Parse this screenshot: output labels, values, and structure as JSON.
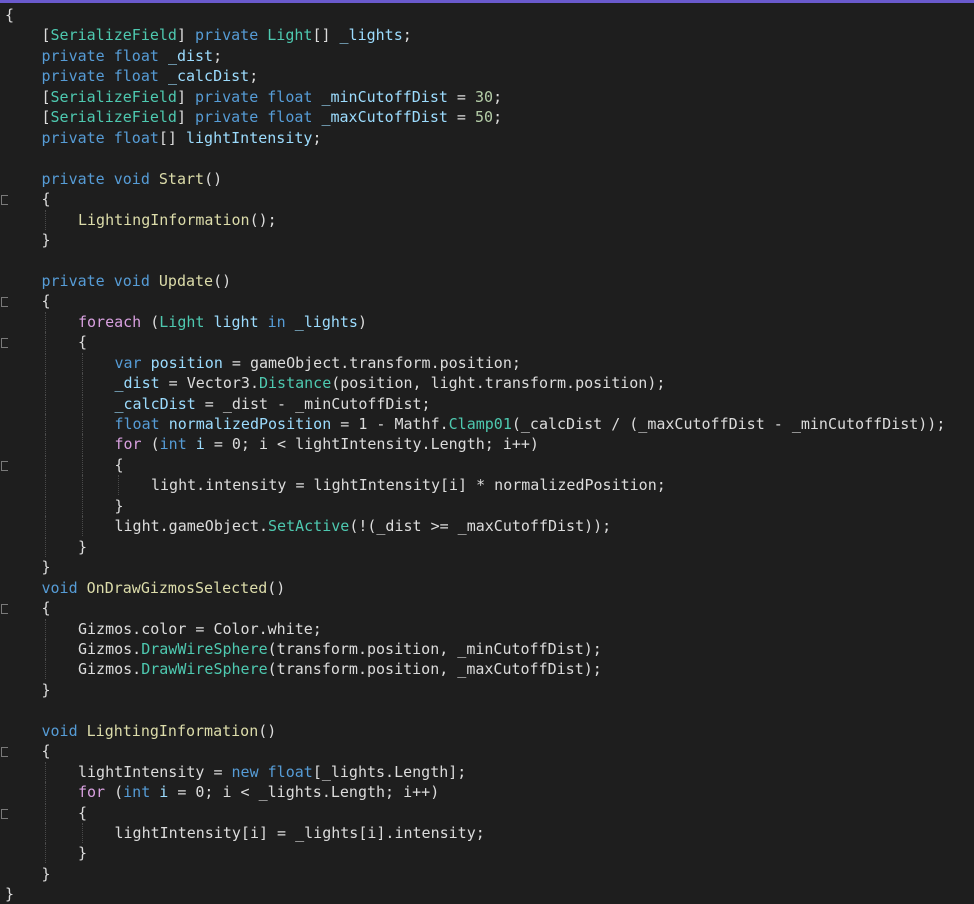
{
  "editor": {
    "lines": [
      {
        "indent": 0,
        "tokens": [
          [
            "br",
            "{"
          ]
        ],
        "fold": false
      },
      {
        "indent": 1,
        "tokens": [
          [
            "br",
            "["
          ],
          [
            "at",
            "SerializeField"
          ],
          [
            "br",
            "] "
          ],
          [
            "kw",
            "private "
          ],
          [
            "ty",
            "Light"
          ],
          [
            "br",
            "[] "
          ],
          [
            "vr",
            "_lights"
          ],
          [
            "br",
            ";"
          ]
        ]
      },
      {
        "indent": 1,
        "tokens": [
          [
            "kw",
            "private "
          ],
          [
            "kw",
            "float "
          ],
          [
            "vr",
            "_dist"
          ],
          [
            "br",
            ";"
          ]
        ]
      },
      {
        "indent": 1,
        "tokens": [
          [
            "kw",
            "private "
          ],
          [
            "kw",
            "float "
          ],
          [
            "vr",
            "_calcDist"
          ],
          [
            "br",
            ";"
          ]
        ]
      },
      {
        "indent": 1,
        "tokens": [
          [
            "br",
            "["
          ],
          [
            "at",
            "SerializeField"
          ],
          [
            "br",
            "] "
          ],
          [
            "kw",
            "private "
          ],
          [
            "kw",
            "float "
          ],
          [
            "vr",
            "_minCutoffDist"
          ],
          [
            "br",
            " = "
          ],
          [
            "nu",
            "30"
          ],
          [
            "br",
            ";"
          ]
        ]
      },
      {
        "indent": 1,
        "tokens": [
          [
            "br",
            "["
          ],
          [
            "at",
            "SerializeField"
          ],
          [
            "br",
            "] "
          ],
          [
            "kw",
            "private "
          ],
          [
            "kw",
            "float "
          ],
          [
            "vr",
            "_maxCutoffDist"
          ],
          [
            "br",
            " = "
          ],
          [
            "nu",
            "50"
          ],
          [
            "br",
            ";"
          ]
        ]
      },
      {
        "indent": 1,
        "tokens": [
          [
            "kw",
            "private "
          ],
          [
            "kw",
            "float"
          ],
          [
            "br",
            "[] "
          ],
          [
            "vr",
            "lightIntensity"
          ],
          [
            "br",
            ";"
          ]
        ]
      },
      {
        "indent": 1,
        "tokens": []
      },
      {
        "indent": 1,
        "tokens": [
          [
            "kw",
            "private "
          ],
          [
            "kw",
            "void "
          ],
          [
            "fn",
            "Start"
          ],
          [
            "br",
            "()"
          ]
        ]
      },
      {
        "indent": 1,
        "tokens": [
          [
            "br",
            "{"
          ]
        ],
        "fold": true
      },
      {
        "indent": 2,
        "tokens": [
          [
            "fn",
            "LightingInformation"
          ],
          [
            "br",
            "();"
          ]
        ]
      },
      {
        "indent": 1,
        "tokens": [
          [
            "br",
            "}"
          ]
        ]
      },
      {
        "indent": 1,
        "tokens": []
      },
      {
        "indent": 1,
        "tokens": [
          [
            "kw",
            "private "
          ],
          [
            "kw",
            "void "
          ],
          [
            "fn",
            "Update"
          ],
          [
            "br",
            "()"
          ]
        ]
      },
      {
        "indent": 1,
        "tokens": [
          [
            "br",
            "{"
          ]
        ],
        "fold": true
      },
      {
        "indent": 2,
        "tokens": [
          [
            "ctl",
            "foreach "
          ],
          [
            "br",
            "("
          ],
          [
            "ty",
            "Light "
          ],
          [
            "vr",
            "light "
          ],
          [
            "kw",
            "in "
          ],
          [
            "vr",
            "_lights"
          ],
          [
            "br",
            ")"
          ]
        ]
      },
      {
        "indent": 2,
        "tokens": [
          [
            "br",
            "{"
          ]
        ],
        "fold": true
      },
      {
        "indent": 3,
        "tokens": [
          [
            "kw",
            "var "
          ],
          [
            "vr",
            "position "
          ],
          [
            "br",
            "= gameObject.transform.position;"
          ]
        ]
      },
      {
        "indent": 3,
        "tokens": [
          [
            "vr",
            "_dist"
          ],
          [
            "br",
            " = Vector3."
          ],
          [
            "mt",
            "Distance"
          ],
          [
            "br",
            "(position, light.transform.position);"
          ]
        ]
      },
      {
        "indent": 3,
        "tokens": [
          [
            "vr",
            "_calcDist"
          ],
          [
            "br",
            " = _dist - _minCutoffDist;"
          ]
        ]
      },
      {
        "indent": 3,
        "tokens": [
          [
            "kw",
            "float "
          ],
          [
            "vr",
            "normalizedPosition"
          ],
          [
            "br",
            " = 1 - Mathf."
          ],
          [
            "mt",
            "Clamp01"
          ],
          [
            "br",
            "(_calcDist / (_maxCutoffDist - _minCutoffDist));"
          ]
        ]
      },
      {
        "indent": 3,
        "tokens": [
          [
            "ctl",
            "for "
          ],
          [
            "br",
            "("
          ],
          [
            "kw",
            "int "
          ],
          [
            "vr",
            "i"
          ],
          [
            "br",
            " = 0; i < lightIntensity.Length; i++)"
          ]
        ]
      },
      {
        "indent": 3,
        "tokens": [
          [
            "br",
            "{"
          ]
        ],
        "fold": true
      },
      {
        "indent": 4,
        "tokens": [
          [
            "br",
            "light.intensity = lightIntensity[i] * normalizedPosition;"
          ]
        ]
      },
      {
        "indent": 3,
        "tokens": [
          [
            "br",
            "}"
          ]
        ]
      },
      {
        "indent": 3,
        "tokens": [
          [
            "br",
            "light.gameObject."
          ],
          [
            "mt",
            "SetActive"
          ],
          [
            "br",
            "(!(_dist >= _maxCutoffDist));"
          ]
        ]
      },
      {
        "indent": 2,
        "tokens": [
          [
            "br",
            "}"
          ]
        ]
      },
      {
        "indent": 1,
        "tokens": [
          [
            "br",
            "}"
          ]
        ]
      },
      {
        "indent": 1,
        "tokens": [
          [
            "kw",
            "void "
          ],
          [
            "fn",
            "OnDrawGizmosSelected"
          ],
          [
            "br",
            "()"
          ]
        ]
      },
      {
        "indent": 1,
        "tokens": [
          [
            "br",
            "{"
          ]
        ],
        "fold": true
      },
      {
        "indent": 2,
        "tokens": [
          [
            "br",
            "Gizmos.color = Color.white;"
          ]
        ]
      },
      {
        "indent": 2,
        "tokens": [
          [
            "br",
            "Gizmos."
          ],
          [
            "mt",
            "DrawWireSphere"
          ],
          [
            "br",
            "(transform.position, _minCutoffDist);"
          ]
        ]
      },
      {
        "indent": 2,
        "tokens": [
          [
            "br",
            "Gizmos."
          ],
          [
            "mt",
            "DrawWireSphere"
          ],
          [
            "br",
            "(transform.position, _maxCutoffDist);"
          ]
        ]
      },
      {
        "indent": 1,
        "tokens": [
          [
            "br",
            "}"
          ]
        ]
      },
      {
        "indent": 1,
        "tokens": []
      },
      {
        "indent": 1,
        "tokens": [
          [
            "kw",
            "void "
          ],
          [
            "fn",
            "LightingInformation"
          ],
          [
            "br",
            "()"
          ]
        ]
      },
      {
        "indent": 1,
        "tokens": [
          [
            "br",
            "{"
          ]
        ],
        "fold": true
      },
      {
        "indent": 2,
        "tokens": [
          [
            "br",
            "lightIntensity = "
          ],
          [
            "kw",
            "new "
          ],
          [
            "kw",
            "float"
          ],
          [
            "br",
            "[_lights.Length];"
          ]
        ]
      },
      {
        "indent": 2,
        "tokens": [
          [
            "ctl",
            "for "
          ],
          [
            "br",
            "("
          ],
          [
            "kw",
            "int "
          ],
          [
            "vr",
            "i"
          ],
          [
            "br",
            " = 0; i < _lights.Length; i++)"
          ]
        ]
      },
      {
        "indent": 2,
        "tokens": [
          [
            "br",
            "{"
          ]
        ],
        "fold": true
      },
      {
        "indent": 3,
        "tokens": [
          [
            "br",
            "lightIntensity[i] = _lights[i].intensity;"
          ]
        ]
      },
      {
        "indent": 2,
        "tokens": [
          [
            "br",
            "}"
          ]
        ]
      },
      {
        "indent": 1,
        "tokens": [
          [
            "br",
            "}"
          ]
        ]
      },
      {
        "indent": 0,
        "tokens": [
          [
            "br",
            "}"
          ]
        ]
      }
    ]
  },
  "colors": {
    "background": "#1e1e1e",
    "keyword": "#569cd6",
    "type": "#4ec9b0",
    "function": "#dcdcaa",
    "number": "#b5cea8",
    "text": "#dcdcdc",
    "control": "#d8a0df"
  }
}
